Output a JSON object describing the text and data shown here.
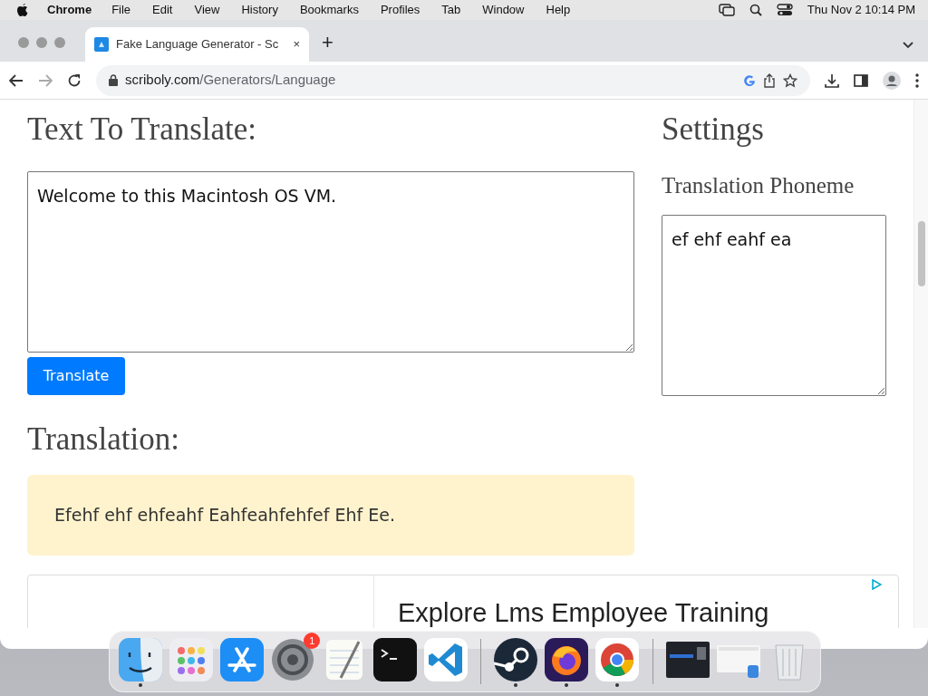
{
  "menu_bar": {
    "app": "Chrome",
    "menus": [
      "File",
      "Edit",
      "View",
      "History",
      "Bookmarks",
      "Profiles",
      "Tab",
      "Window",
      "Help"
    ],
    "clock": "Thu Nov 2  10:14 PM"
  },
  "browser": {
    "tab": {
      "title": "Fake Language Generator - Sc",
      "close": "×",
      "selected": true
    },
    "new_tab": "+",
    "forward_disabled": true,
    "address": {
      "domain": "scriboly.com",
      "path": "/Generators/Language"
    }
  },
  "page": {
    "input_heading": "Text To Translate:",
    "input_text": "Welcome to this Macintosh OS VM.",
    "translate_button": "Translate",
    "output_heading": "Translation:",
    "output_text": "Efehf ehf ehfeahf Eahfeahfehfef Ehf Ee.",
    "settings_heading": "Settings",
    "phoneme_label": "Translation Phoneme",
    "phoneme_text": "ef ehf eahf ea",
    "ad_headline": "Explore Lms Employee Training"
  },
  "dock": {
    "items": [
      {
        "kind": "finder",
        "running": true
      },
      {
        "kind": "launchpad",
        "running": false
      },
      {
        "kind": "appstore",
        "running": false
      },
      {
        "kind": "settings",
        "running": false,
        "badge": "1"
      },
      {
        "kind": "textedit",
        "running": false
      },
      {
        "kind": "terminal",
        "running": false
      },
      {
        "kind": "vscode",
        "running": false
      },
      {
        "kind": "divider"
      },
      {
        "kind": "steam",
        "running": true
      },
      {
        "kind": "firefox",
        "running": true
      },
      {
        "kind": "chrome",
        "running": true
      },
      {
        "kind": "divider"
      },
      {
        "kind": "window-dark",
        "running": false
      },
      {
        "kind": "window-light",
        "running": false
      },
      {
        "kind": "trash",
        "running": false
      }
    ]
  }
}
